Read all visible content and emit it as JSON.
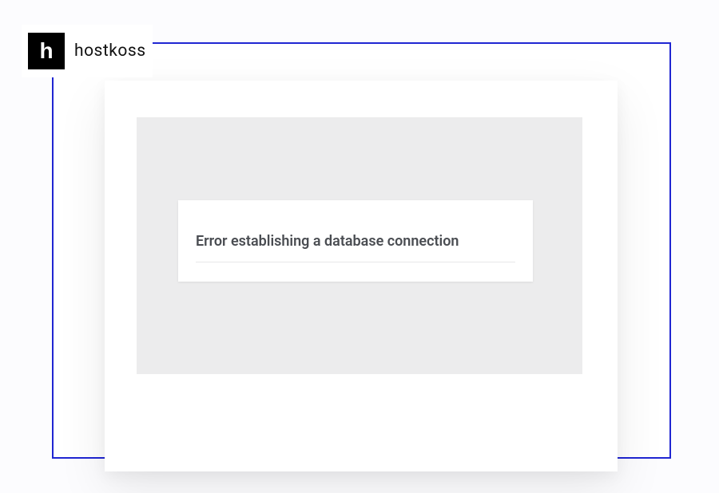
{
  "brand": {
    "logo_letter": "h",
    "name": "hostkoss"
  },
  "error": {
    "message": "Error establishing a database connection"
  }
}
